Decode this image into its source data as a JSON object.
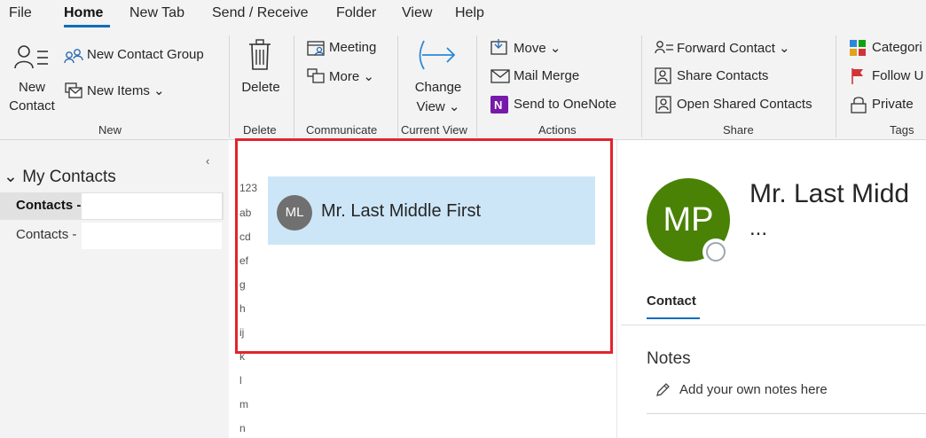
{
  "menu": {
    "tabs": [
      "File",
      "Home",
      "New Tab",
      "Send / Receive",
      "Folder",
      "View",
      "Help"
    ]
  },
  "ribbon": {
    "new_group": {
      "new_contact_line1": "New",
      "new_contact_line2": "Contact",
      "new_contact_group": "New Contact Group",
      "new_items": "New Items ⌄",
      "label": "New"
    },
    "delete_group": {
      "delete": "Delete",
      "label": "Delete"
    },
    "communicate_group": {
      "meeting": "Meeting",
      "more": "More ⌄",
      "label": "Communicate"
    },
    "current_view_group": {
      "change": "Change",
      "view": "View ⌄",
      "label": "Current View"
    },
    "actions_group": {
      "move": "Move ⌄",
      "mail_merge": "Mail Merge",
      "send_onenote": "Send to OneNote",
      "label": "Actions"
    },
    "share_group": {
      "forward_contact": "Forward Contact ⌄",
      "share_contacts": "Share Contacts",
      "open_shared": "Open Shared Contacts",
      "label": "Share"
    },
    "tags_group": {
      "categorize": "Categori",
      "follow_up": "Follow U",
      "private": "Private",
      "label": "Tags"
    }
  },
  "sidebar": {
    "collapse_arrow": "‹",
    "heading": "My Contacts",
    "items": [
      "Contacts -",
      "Contacts -"
    ]
  },
  "alphabet": [
    "123",
    "ab",
    "cd",
    "ef",
    "g",
    "h",
    "ij",
    "k",
    "l",
    "m",
    "n"
  ],
  "contact_list": {
    "initials": "ML",
    "name": "Mr. Last Middle First"
  },
  "reading_pane": {
    "initials": "MP",
    "full_name": "Mr. Last Midd",
    "ellipsis": "...",
    "tab": "Contact",
    "notes_label": "Notes",
    "notes_placeholder": "Add your own notes here"
  },
  "colors": {
    "accent": "#0f6cbd",
    "highlight_box": "#e3242b",
    "selected_contact": "#cde6f7",
    "avatar_green": "#498205",
    "onenote_purple": "#7719aa"
  }
}
